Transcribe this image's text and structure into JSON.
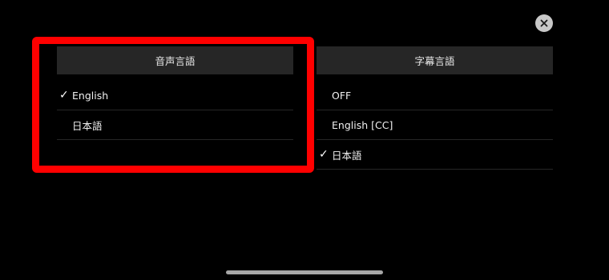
{
  "audio": {
    "header": "音声言語",
    "options": [
      {
        "label": "English",
        "selected": true
      },
      {
        "label": "日本語",
        "selected": false
      }
    ]
  },
  "subtitles": {
    "header": "字幕言語",
    "options": [
      {
        "label": "OFF",
        "selected": false
      },
      {
        "label": "English [CC]",
        "selected": false
      },
      {
        "label": "日本語",
        "selected": true
      }
    ]
  },
  "check_glyph": "✓",
  "colors": {
    "background": "#000000",
    "header_bg": "#262626",
    "highlight": "#ff0000",
    "close_button": "#c8c8c8"
  },
  "icons": {
    "close": "close-icon",
    "check": "check-icon"
  }
}
